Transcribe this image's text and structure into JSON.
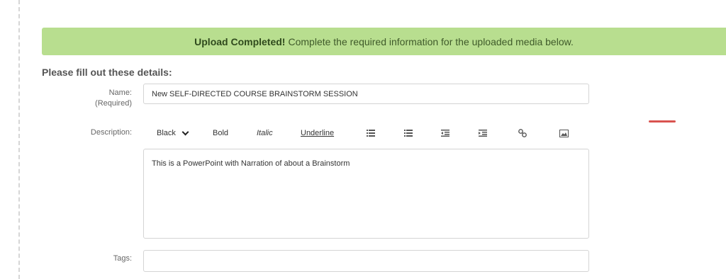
{
  "banner": {
    "strong": "Upload Completed!",
    "message": "Complete the required information for the uploaded media below."
  },
  "form": {
    "section_title": "Please fill out these details:",
    "name_label": "Name:",
    "name_required": "(Required)",
    "name_value": "New  SELF-DIRECTED COURSE BRAINSTORM SESSION",
    "description_label": "Description:",
    "description_value": "This is a PowerPoint with Narration of about a Brainstorm",
    "tags_label": "Tags:",
    "tags_value": ""
  },
  "toolbar": {
    "color_select": "Black",
    "bold": "Bold",
    "italic": "Italic",
    "underline": "Underline",
    "icons": [
      "bullet-list-icon",
      "numbered-list-icon",
      "outdent-icon",
      "indent-icon",
      "link-icon",
      "image-icon"
    ]
  },
  "colors": {
    "banner_bg": "#b8de8f",
    "accent_red": "#d9534f"
  }
}
